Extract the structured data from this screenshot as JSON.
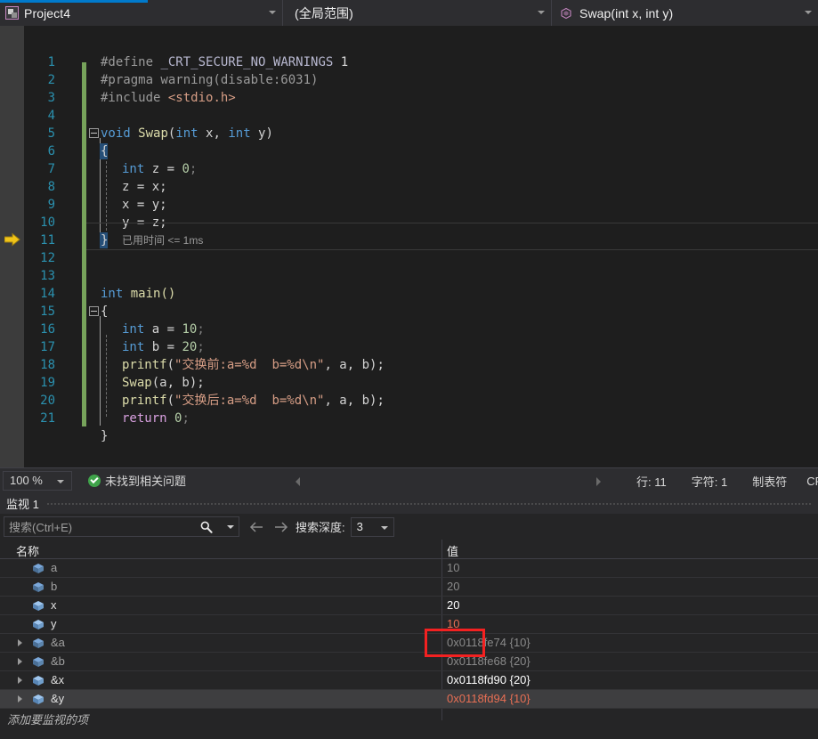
{
  "navbar": {
    "project": "Project4",
    "project_icon": "project-icon",
    "scope": "(全局范围)",
    "member": "Swap(int x, int y)",
    "member_icon": "method-icon",
    "accent_color": "#007acc"
  },
  "editor": {
    "lines": [
      {
        "n": "1",
        "text": "#define _CRT_SECURE_NO_WARNINGS 1"
      },
      {
        "n": "2",
        "text": "#pragma warning(disable:6031)"
      },
      {
        "n": "3",
        "text": "#include <stdio.h>"
      },
      {
        "n": "4",
        "text": ""
      },
      {
        "n": "5",
        "text": "void Swap(int x, int y)"
      },
      {
        "n": "6",
        "text": "{"
      },
      {
        "n": "7",
        "text": "    int z = 0;"
      },
      {
        "n": "8",
        "text": "    z = x;"
      },
      {
        "n": "9",
        "text": "    x = y;"
      },
      {
        "n": "10",
        "text": "    y = z;"
      },
      {
        "n": "11",
        "text": "}"
      },
      {
        "n": "12",
        "text": ""
      },
      {
        "n": "13",
        "text": "int main()"
      },
      {
        "n": "14",
        "text": "{"
      },
      {
        "n": "15",
        "text": "    int a = 10;"
      },
      {
        "n": "16",
        "text": "    int b = 20;"
      },
      {
        "n": "17",
        "text": "    printf(\"交换前:a=%d  b=%d\\n\", a, b);"
      },
      {
        "n": "18",
        "text": "    Swap(a, b);"
      },
      {
        "n": "19",
        "text": "    printf(\"交换后:a=%d  b=%d\\n\", a, b);"
      },
      {
        "n": "20",
        "text": "    return 0;"
      },
      {
        "n": "21",
        "text": "}"
      }
    ],
    "elapsed_annotation": "已用时间 <= 1ms",
    "current_line": "11",
    "tok": {
      "l1_define": "#define",
      "l1_macro": "_CRT_SECURE_NO_WARNINGS",
      "l1_num": "1",
      "l2_pragma": "#pragma warning(disable:6031)",
      "l3_include": "#include",
      "l3_header": "<stdio.h>",
      "l5_void": "void",
      "l5_name": "Swap",
      "l5_open": "(",
      "l5_int1": "int",
      "l5_x": " x,",
      "l5_int2": " int",
      "l5_y": " y)",
      "brace_open": "{",
      "brace_close": "}",
      "l7_int": "int",
      "l7_z": " z = ",
      "l7_zero": "0",
      "l7_semi": ";",
      "l8": "z = x;",
      "l9": "x = y;",
      "l10": "y = z;",
      "l13_int": "int",
      "l13_main": " main()",
      "l15_int": "int",
      "l15_a": " a = ",
      "l15_v": "10",
      "l15_semi": ";",
      "l16_int": "int",
      "l16_b": " b = ",
      "l16_v": "20",
      "l16_semi": ";",
      "l17_fn": "printf",
      "l17_p1": "(",
      "l17_str": "\"交换前:a=%d  b=%d\\n\"",
      "l17_tail": ", a, b);",
      "l18_fn": "Swap",
      "l18_tail": "(a, b);",
      "l19_fn": "printf",
      "l19_p1": "(",
      "l19_str": "\"交换后:a=%d  b=%d\\n\"",
      "l19_tail": ", a, b);",
      "l20_ret": "return",
      "l20_zero": " 0",
      "l20_semi": ";"
    }
  },
  "statusbar": {
    "zoom": "100 %",
    "problems": "未找到相关问题",
    "problems_icon": "check-circle-icon",
    "line": "行: 11",
    "char": "字符: 1",
    "tabs": "制表符",
    "eol": "CR"
  },
  "watch": {
    "title": "监视 1",
    "search_placeholder": "搜索(Ctrl+E)",
    "search_icon": "magnifier-icon",
    "back_icon": "arrow-left-icon",
    "forward_icon": "arrow-right-icon",
    "depth_label": "搜索深度:",
    "depth_value": "3",
    "columns": [
      "名称",
      "值"
    ],
    "rows": [
      {
        "name": "a",
        "value": "10",
        "expandable": false,
        "state": "dim",
        "selected": false
      },
      {
        "name": "b",
        "value": "20",
        "expandable": false,
        "state": "dim",
        "selected": false
      },
      {
        "name": "x",
        "value": "20",
        "expandable": false,
        "state": "bright",
        "selected": false
      },
      {
        "name": "y",
        "value": "10",
        "expandable": false,
        "state": "changed",
        "selected": false
      },
      {
        "name": "&a",
        "value": "0x0118fe74 {10}",
        "expandable": true,
        "state": "dim",
        "selected": false
      },
      {
        "name": "&b",
        "value": "0x0118fe68 {20}",
        "expandable": true,
        "state": "dim",
        "selected": false
      },
      {
        "name": "&x",
        "value": "0x0118fd90 {20}",
        "expandable": true,
        "state": "bright",
        "selected": false
      },
      {
        "name": "&y",
        "value": "0x0118fd94 {10}",
        "expandable": true,
        "state": "changed",
        "selected": true
      }
    ],
    "add_item_placeholder": "添加要监视的项",
    "highlight_color": "#f32121"
  }
}
